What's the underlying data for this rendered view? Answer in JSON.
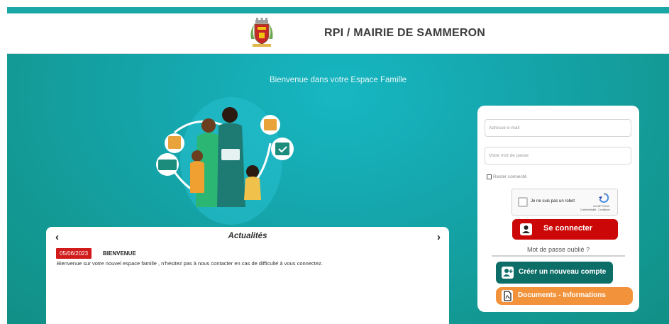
{
  "header": {
    "title": "RPI / MAIRIE DE SAMMERON"
  },
  "hero": {
    "welcome": "Bienvenue dans votre Espace Famille"
  },
  "news": {
    "heading": "Actualités",
    "prev": "‹",
    "next": "›",
    "items": [
      {
        "date": "05/06/2023",
        "title": "BIENVENUE",
        "text": "Bienvenue sur votre  nouvel espace famille , n'hésitez pas à nous contacter en cas de difficulté à vous connectez."
      }
    ]
  },
  "login": {
    "email_placeholder": "Adresse e-mail",
    "password_placeholder": "Votre mot de passe",
    "remember_label": "Rester connecté",
    "captcha": {
      "label": "Je ne suis pas un robot",
      "brand": "reCAPTCHA",
      "links": "Confidentialité - Conditions"
    },
    "connect_label": "Se connecter",
    "forgot_label": "Mot de passe oublié ?",
    "create_label": "Créer un nouveau compte",
    "docs_label": "Documents - Informations"
  },
  "colors": {
    "accent": "#1aa7a6",
    "hero": "#139a96",
    "connect": "#cc0707",
    "create": "#0d6e68",
    "docs": "#f2933b",
    "date_badge": "#d11b1b"
  }
}
